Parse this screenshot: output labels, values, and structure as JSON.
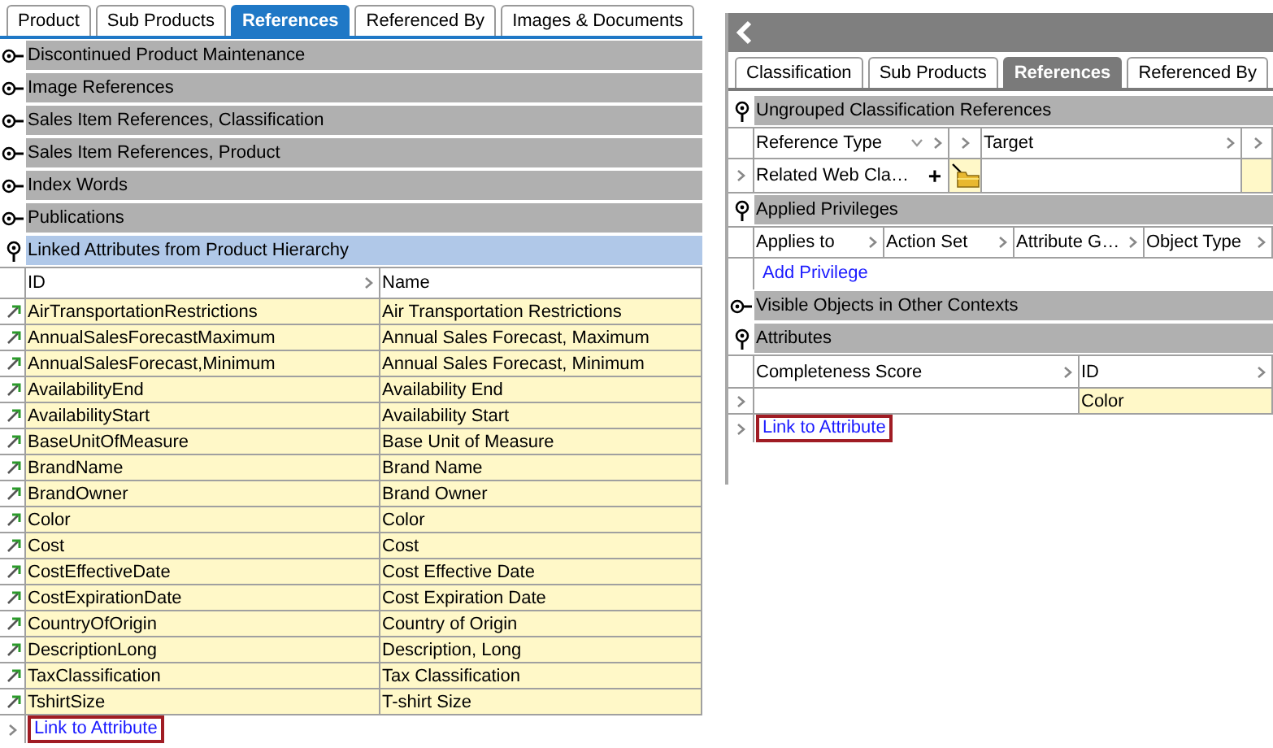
{
  "left_panel": {
    "tabs": [
      {
        "label": "Product",
        "selected": false
      },
      {
        "label": "Sub Products",
        "selected": false
      },
      {
        "label": "References",
        "selected": true
      },
      {
        "label": "Referenced By",
        "selected": false
      },
      {
        "label": "Images & Documents",
        "selected": false
      }
    ],
    "sections": [
      {
        "title": "Discontinued Product Maintenance",
        "expanded": false,
        "selected": false
      },
      {
        "title": "Image References",
        "expanded": false,
        "selected": false
      },
      {
        "title": "Sales Item References, Classification",
        "expanded": false,
        "selected": false
      },
      {
        "title": "Sales Item References, Product",
        "expanded": false,
        "selected": false
      },
      {
        "title": "Index Words",
        "expanded": false,
        "selected": false
      },
      {
        "title": "Publications",
        "expanded": false,
        "selected": false
      },
      {
        "title": "Linked Attributes from Product Hierarchy",
        "expanded": true,
        "selected": true,
        "table": {
          "kind": "linked",
          "columns": [
            "ID",
            "Name"
          ],
          "rows": [
            [
              "AirTransportationRestrictions",
              "Air Transportation Restrictions"
            ],
            [
              "AnnualSalesForecastMaximum",
              "Annual Sales Forecast, Maximum"
            ],
            [
              "AnnualSalesForecast,Minimum",
              "Annual Sales Forecast, Minimum"
            ],
            [
              "AvailabilityEnd",
              "Availability End"
            ],
            [
              "AvailabilityStart",
              "Availability Start"
            ],
            [
              "BaseUnitOfMeasure",
              "Base Unit of Measure"
            ],
            [
              "BrandName",
              "Brand Name"
            ],
            [
              "BrandOwner",
              "Brand Owner"
            ],
            [
              "Color",
              "Color"
            ],
            [
              "Cost",
              "Cost"
            ],
            [
              "CostEffectiveDate",
              "Cost Effective Date"
            ],
            [
              "CostExpirationDate",
              "Cost Expiration Date"
            ],
            [
              "CountryOfOrigin",
              "Country of Origin"
            ],
            [
              "DescriptionLong",
              "Description, Long"
            ],
            [
              "TaxClassification",
              "Tax Classification"
            ],
            [
              "TshirtSize",
              "T-shirt Size"
            ]
          ],
          "action": {
            "label": "Link to Attribute",
            "highlighted": true
          }
        }
      }
    ]
  },
  "right_panel": {
    "tabs": [
      {
        "label": "Classification",
        "selected": false
      },
      {
        "label": "Sub Products",
        "selected": false
      },
      {
        "label": "References",
        "selected": true
      },
      {
        "label": "Referenced By",
        "selected": false
      }
    ],
    "sections": [
      {
        "title": "Ungrouped Classification References",
        "expanded": true,
        "table": {
          "kind": "references",
          "columns": [
            "Reference Type",
            "Target"
          ],
          "rows": [
            {
              "cells": [
                "Related Web Cla…"
              ],
              "add": "+"
            }
          ]
        }
      },
      {
        "title": "Applied Privileges",
        "expanded": true,
        "table": {
          "kind": "privileges",
          "columns": [
            "Applies to",
            "Action Set",
            "Attribute G…",
            "Object Type"
          ],
          "action": {
            "label": "Add Privilege",
            "highlighted": false
          }
        }
      },
      {
        "title": "Visible Objects in Other Contexts",
        "expanded": false
      },
      {
        "title": "Attributes",
        "expanded": true,
        "table": {
          "kind": "attributes",
          "columns": [
            "Completeness Score",
            "ID"
          ],
          "rows": [
            {
              "cells": [
                "",
                "Color"
              ]
            }
          ],
          "action": {
            "label": "Link to Attribute",
            "highlighted": true
          }
        }
      }
    ]
  }
}
